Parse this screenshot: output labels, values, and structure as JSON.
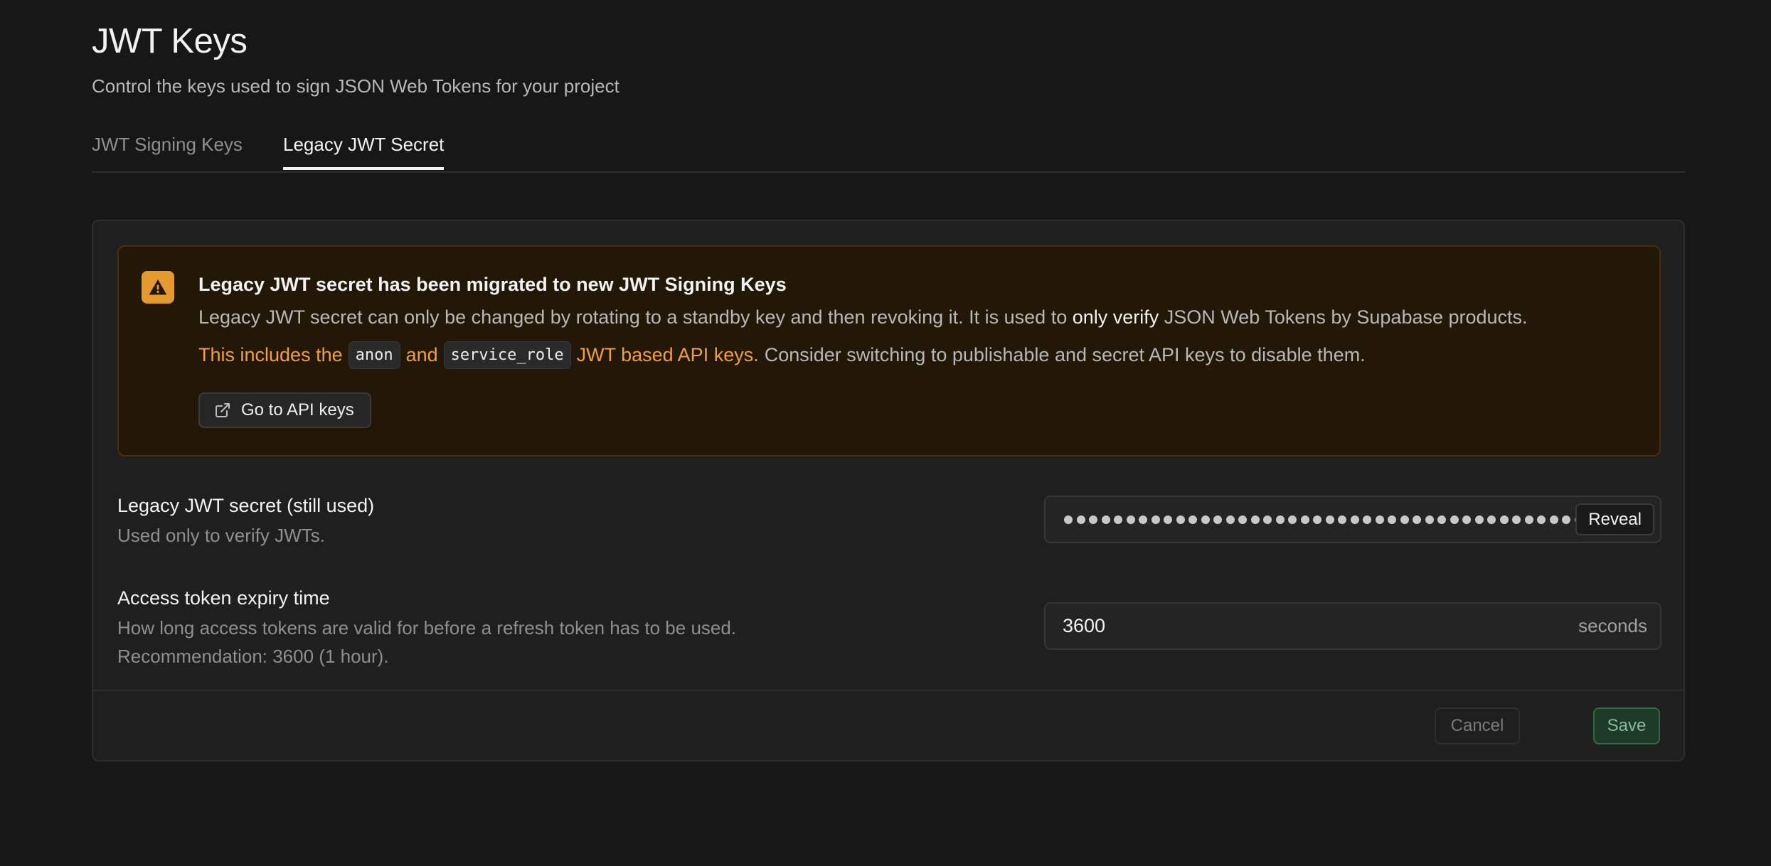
{
  "header": {
    "title": "JWT Keys",
    "subtitle": "Control the keys used to sign JSON Web Tokens for your project"
  },
  "tabs": [
    {
      "label": "JWT Signing Keys",
      "active": false
    },
    {
      "label": "Legacy JWT Secret",
      "active": true
    }
  ],
  "alert": {
    "icon": "warning-icon",
    "title": "Legacy JWT secret has been migrated to new JWT Signing Keys",
    "body_pre": "Legacy JWT secret can only be changed by rotating to a standby key and then revoking it. It is used to ",
    "body_highlight": "only verify",
    "body_post": " JSON Web Tokens by Supabase products.",
    "line2_pre": "This includes the",
    "code_anon": "anon",
    "line2_mid": "and",
    "code_service": "service_role",
    "line2_orange_end": "JWT based API keys.",
    "line2_rest": "Consider switching to publishable and secret API keys to disable them.",
    "button_label": "Go to API keys",
    "button_icon": "external-link-icon"
  },
  "secret_row": {
    "label": "Legacy JWT secret (still used)",
    "description": "Used only to verify JWTs.",
    "reveal_label": "Reveal"
  },
  "expiry_row": {
    "label": "Access token expiry time",
    "description_line1": "How long access tokens are valid for before a refresh token has to be used.",
    "description_line2": "Recommendation: 3600 (1 hour).",
    "value": "3600",
    "suffix": "seconds"
  },
  "footer": {
    "cancel_label": "Cancel",
    "save_label": "Save"
  },
  "colors": {
    "background": "#171717",
    "card": "#1f1f1f",
    "warning_bg": "#231808",
    "warning_accent": "#e59a30",
    "save_green": "#1e3b29"
  }
}
